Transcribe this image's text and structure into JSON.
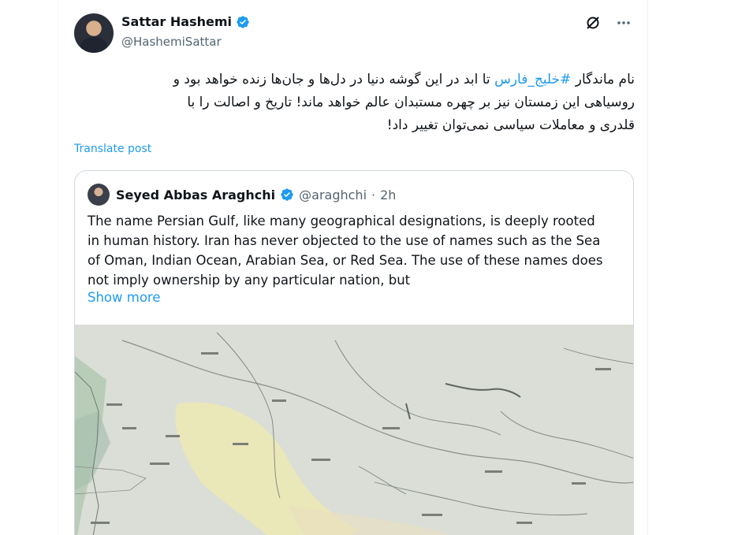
{
  "post": {
    "author_name": "Sattar Hashemi",
    "author_handle": "@HashemiSattar",
    "text_lines": [
      {
        "before": "نام ماندگار ",
        "hashtag": "#خلیج_فارس",
        "after": " تا ابد در این گوشه دنیا در دل‌ها و جان‌ها زنده خواهد بود و"
      },
      {
        "before": "روسیاهی این زمستان نیز بر چهره مستبدان عالم خواهد ماند! تاریخ و اصالت را با",
        "hashtag": "",
        "after": ""
      },
      {
        "before": "قلدری و معاملات سیاسی نمی‌توان تغییر داد!",
        "hashtag": "",
        "after": ""
      }
    ],
    "translate_label": "Translate post",
    "icons": {
      "grok": "slashed-circle-icon",
      "more": "more-dots-icon"
    }
  },
  "quote": {
    "author_name": "Seyed Abbas Araghchi",
    "author_handle": "@araghchi",
    "separator": "·",
    "time": "2h",
    "text_lines": [
      "The name Persian Gulf, like many geographical designations, is deeply rooted",
      "in human history. Iran has never objected to the use of names such as the Sea",
      "of Oman, Indian Ocean, Arabian Sea, or Red Sea. The use of these names does",
      "not imply ownership by any particular nation, but"
    ],
    "show_more_label": "Show more",
    "image": {
      "name": "historical-map-image",
      "base_color": "#cfd6d0",
      "region_color": "#ece9b4"
    }
  },
  "colors": {
    "accent": "#1d9bf0",
    "text": "#0f1419",
    "muted": "#536471",
    "border": "#cfd9de"
  }
}
